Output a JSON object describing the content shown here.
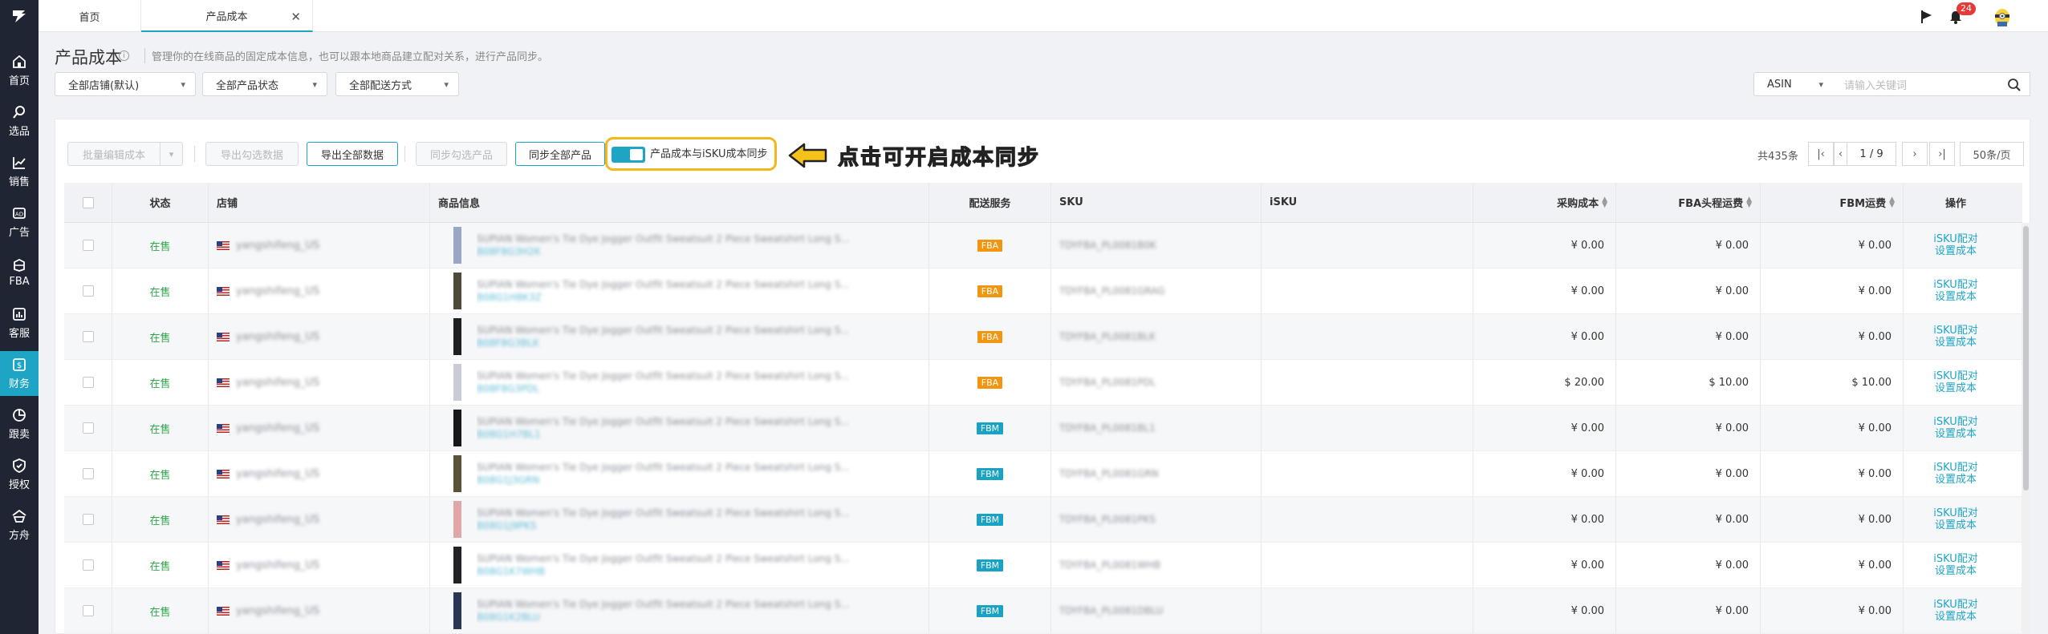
{
  "sidebar": {
    "items": [
      {
        "label": "首页",
        "icon": "home-icon"
      },
      {
        "label": "选品",
        "icon": "search-icon"
      },
      {
        "label": "销售",
        "icon": "line-chart-icon"
      },
      {
        "label": "广告",
        "icon": "ad-icon"
      },
      {
        "label": "FBA",
        "icon": "box-icon"
      },
      {
        "label": "客服",
        "icon": "bar-chart-icon"
      },
      {
        "label": "财务",
        "icon": "dollar-icon",
        "active": true
      },
      {
        "label": "跟卖",
        "icon": "pie-icon"
      },
      {
        "label": "授权",
        "icon": "shield-icon"
      },
      {
        "label": "方舟",
        "icon": "ark-icon"
      }
    ]
  },
  "tabs": [
    {
      "label": "首页"
    },
    {
      "label": "产品成本",
      "active": true
    }
  ],
  "topbar": {
    "notification_count": "24"
  },
  "page": {
    "title": "产品成本",
    "description": "管理你的在线商品的固定成本信息，也可以跟本地商品建立配对关系，进行产品同步。"
  },
  "filters": {
    "store": "全部店铺(默认)",
    "product_status": "全部产品状态",
    "delivery": "全部配送方式",
    "search_field": "ASIN",
    "search_placeholder": "请输入关键词"
  },
  "toolbar": {
    "batch_edit": "批量编辑成本",
    "export_selected": "导出勾选数据",
    "export_all": "导出全部数据",
    "sync_selected": "同步勾选产品",
    "sync_all": "同步全部产品",
    "toggle_label": "产品成本与iSKU成本同步",
    "toggle_on": true,
    "annotation": "点击可开启成本同步"
  },
  "pagination": {
    "total": "共435条",
    "current": "1",
    "pages": "/ 9",
    "page_size": "50条/页"
  },
  "table": {
    "headers": {
      "status": "状态",
      "store": "店铺",
      "product": "商品信息",
      "shipping": "配送服务",
      "sku": "SKU",
      "isku": "iSKU",
      "purchase_cost": "采购成本",
      "fba_freight": "FBA头程运费",
      "fbm_freight": "FBM运费",
      "actions": "操作"
    },
    "rows": [
      {
        "status": "在售",
        "store": "yangshifeng_US",
        "title": "SUPIAN Women's Tie Dye Jogger Outfit Sweatsuit 2 Piece Sweatshirt Long S...",
        "asin": "B08F8G3H2K",
        "ship": "FBA",
        "sku": "TDYFBA_PL0081B0K",
        "purchase": "¥ 0.00",
        "fba": "¥ 0.00",
        "fbm": "¥ 0.00",
        "op1": "iSKU配对",
        "op2": "设置成本",
        "thumb": "#9aa6c8"
      },
      {
        "status": "在售",
        "store": "yangshifeng_US",
        "title": "SUPIAN Women's Tie Dye Jogger Outfit Sweatsuit 2 Piece Sweatshirt Long S...",
        "asin": "B08G1H8K3Z",
        "ship": "FBA",
        "sku": "TDYFBA_PL0081GRAG",
        "purchase": "¥ 0.00",
        "fba": "¥ 0.00",
        "fbm": "¥ 0.00",
        "op1": "iSKU配对",
        "op2": "设置成本",
        "thumb": "#4d4a3a"
      },
      {
        "status": "在售",
        "store": "yangshifeng_US",
        "title": "SUPIAN Women's Tie Dye Jogger Outfit Sweatsuit 2 Piece Sweatshirt Long S...",
        "asin": "B08F8G3BLK",
        "ship": "FBA",
        "sku": "TDYFBA_PL0081BLK",
        "purchase": "¥ 0.00",
        "fba": "¥ 0.00",
        "fbm": "¥ 0.00",
        "op1": "iSKU配对",
        "op2": "设置成本",
        "thumb": "#1f1f22"
      },
      {
        "status": "在售",
        "store": "yangshifeng_US",
        "title": "SUPIAN Women's Tie Dye Jogger Outfit Sweatsuit 2 Piece Sweatshirt Long S...",
        "asin": "B08F8G3PDL",
        "ship": "FBA",
        "sku": "TDYFBA_PL0081PDL",
        "purchase": "$ 20.00",
        "fba": "$ 10.00",
        "fbm": "$ 10.00",
        "op1": "iSKU配对",
        "op2": "设置成本",
        "thumb": "#c9ccd6"
      },
      {
        "status": "在售",
        "store": "yangshifeng_US",
        "title": "SUPIAN Women's Tie Dye Jogger Outfit Sweatsuit 2 Piece Sweatshirt Long S...",
        "asin": "B08G1H7BL1",
        "ship": "FBM",
        "sku": "TDYFBA_PL0081BL1",
        "purchase": "¥ 0.00",
        "fba": "¥ 0.00",
        "fbm": "¥ 0.00",
        "op1": "iSKU配对",
        "op2": "设置成本",
        "thumb": "#18181b"
      },
      {
        "status": "在售",
        "store": "yangshifeng_US",
        "title": "SUPIAN Women's Tie Dye Jogger Outfit Sweatsuit 2 Piece Sweatshirt Long S...",
        "asin": "B08G1J3GRN",
        "ship": "FBM",
        "sku": "TDYFBA_PL0081GRN",
        "purchase": "¥ 0.00",
        "fba": "¥ 0.00",
        "fbm": "¥ 0.00",
        "op1": "iSKU配对",
        "op2": "设置成本",
        "thumb": "#5a5236"
      },
      {
        "status": "在售",
        "store": "yangshifeng_US",
        "title": "SUPIAN Women's Tie Dye Jogger Outfit Sweatsuit 2 Piece Sweatshirt Long S...",
        "asin": "B08G1J9PKS",
        "ship": "FBM",
        "sku": "TDYFBA_PL0081PKS",
        "purchase": "¥ 0.00",
        "fba": "¥ 0.00",
        "fbm": "¥ 0.00",
        "op1": "iSKU配对",
        "op2": "设置成本",
        "thumb": "#e3a6a8"
      },
      {
        "status": "在售",
        "store": "yangshifeng_US",
        "title": "SUPIAN Women's Tie Dye Jogger Outfit Sweatsuit 2 Piece Sweatshirt Long S...",
        "asin": "B08G1K7WHB",
        "ship": "FBM",
        "sku": "TDYFBA_PL0081WHB",
        "purchase": "¥ 0.00",
        "fba": "¥ 0.00",
        "fbm": "¥ 0.00",
        "op1": "iSKU配对",
        "op2": "设置成本",
        "thumb": "#222226"
      },
      {
        "status": "在售",
        "store": "yangshifeng_US",
        "title": "SUPIAN Women's Tie Dye Jogger Outfit Sweatsuit 2 Piece Sweatshirt Long S...",
        "asin": "B08G1K2BLU",
        "ship": "FBM",
        "sku": "TDYFBA_PL0081DBLU",
        "purchase": "¥ 0.00",
        "fba": "¥ 0.00",
        "fbm": "¥ 0.00",
        "op1": "iSKU配对",
        "op2": "设置成本",
        "thumb": "#2a3654"
      }
    ]
  },
  "colors": {
    "accent": "#1ea5c6",
    "sidebar": "#1f2532",
    "status_green": "#2ea84a",
    "fba_badge": "#f29611",
    "fbm_badge": "#18a3c4",
    "annotation": "#f5c21b"
  }
}
